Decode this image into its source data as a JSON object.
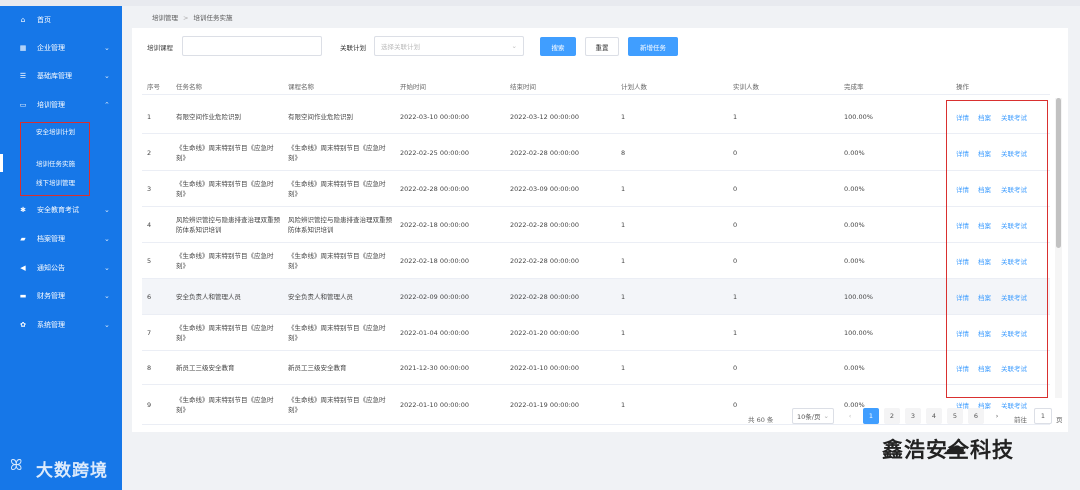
{
  "sidebar": {
    "items": [
      {
        "label": "首页",
        "icon": "home-icon",
        "glyph": "⌂"
      },
      {
        "label": "企业管理",
        "icon": "building-icon",
        "glyph": "▦"
      },
      {
        "label": "基础库管理",
        "icon": "list-icon",
        "glyph": "☰"
      },
      {
        "label": "培训管理",
        "icon": "monitor-icon",
        "glyph": "▭"
      },
      {
        "label": "安全教育考试",
        "icon": "gear-icon",
        "glyph": "✱"
      },
      {
        "label": "档案管理",
        "icon": "folder-icon",
        "glyph": "▰"
      },
      {
        "label": "通知公告",
        "icon": "megaphone-icon",
        "glyph": "◀"
      },
      {
        "label": "财务管理",
        "icon": "card-icon",
        "glyph": "▬"
      },
      {
        "label": "系统管理",
        "icon": "settings-icon",
        "glyph": "✿"
      }
    ],
    "sub_items": [
      "安全培训计划",
      "培训任务实施",
      "线下培训管理"
    ],
    "logo_text": "大数跨境"
  },
  "breadcrumb": [
    "培训管理",
    "培训任务实施"
  ],
  "filters": {
    "course_label": "培训课程",
    "course_value": "",
    "plan_label": "关联计划",
    "plan_placeholder": "选择关联计划",
    "search_btn": "搜索",
    "reset_btn": "重置",
    "new_btn": "新增任务"
  },
  "table": {
    "headers": [
      "序号",
      "任务名称",
      "课程名称",
      "开始时间",
      "结束时间",
      "计划人数",
      "实训人数",
      "完成率",
      "操作"
    ],
    "rows": [
      {
        "no": "1",
        "task": "有限空间作业危险识别",
        "course": "有限空间作业危险识别",
        "start": "2022-03-10 00:00:00",
        "end": "2022-03-12 00:00:00",
        "plan": "1",
        "actual": "1",
        "rate": "100.00%"
      },
      {
        "no": "2",
        "task": "《生命线》周末特别节目《应急时刻》",
        "course": "《生命线》周末特别节目《应急时刻》",
        "start": "2022-02-25 00:00:00",
        "end": "2022-02-28 00:00:00",
        "plan": "8",
        "actual": "0",
        "rate": "0.00%"
      },
      {
        "no": "3",
        "task": "《生命线》周末特别节目《应急时刻》",
        "course": "《生命线》周末特别节目《应急时刻》",
        "start": "2022-02-28 00:00:00",
        "end": "2022-03-09 00:00:00",
        "plan": "1",
        "actual": "0",
        "rate": "0.00%"
      },
      {
        "no": "4",
        "task": "风险辨识管控与隐患排查治理双重预防体系知识培训",
        "course": "风险辨识管控与隐患排查治理双重预防体系知识培训",
        "start": "2022-02-18 00:00:00",
        "end": "2022-02-28 00:00:00",
        "plan": "1",
        "actual": "0",
        "rate": "0.00%"
      },
      {
        "no": "5",
        "task": "《生命线》周末特别节目《应急时刻》",
        "course": "《生命线》周末特别节目《应急时刻》",
        "start": "2022-02-18 00:00:00",
        "end": "2022-02-28 00:00:00",
        "plan": "1",
        "actual": "0",
        "rate": "0.00%"
      },
      {
        "no": "6",
        "task": "安全负责人和管理人员",
        "course": "安全负责人和管理人员",
        "start": "2022-02-09 00:00:00",
        "end": "2022-02-28 00:00:00",
        "plan": "1",
        "actual": "1",
        "rate": "100.00%"
      },
      {
        "no": "7",
        "task": "《生命线》周末特别节目《应急时刻》",
        "course": "《生命线》周末特别节目《应急时刻》",
        "start": "2022-01-04 00:00:00",
        "end": "2022-01-20 00:00:00",
        "plan": "1",
        "actual": "1",
        "rate": "100.00%"
      },
      {
        "no": "8",
        "task": "新员工三级安全教育",
        "course": "新员工三级安全教育",
        "start": "2021-12-30 00:00:00",
        "end": "2022-01-10 00:00:00",
        "plan": "1",
        "actual": "0",
        "rate": "0.00%"
      },
      {
        "no": "9",
        "task": "《生命线》周末特别节目《应急时刻》",
        "course": "《生命线》周末特别节目《应急时刻》",
        "start": "2022-01-10 00:00:00",
        "end": "2022-01-19 00:00:00",
        "plan": "1",
        "actual": "0",
        "rate": "0.00%"
      }
    ],
    "ops": [
      "详情",
      "档案",
      "关联考试"
    ]
  },
  "pagination": {
    "total": "共 60 条",
    "page_size": "10条/页",
    "pages": [
      "1",
      "2",
      "3",
      "4",
      "5",
      "6"
    ],
    "prev": "‹",
    "next": "›",
    "goto_label": "前往",
    "goto_value": "1",
    "page_suffix": "页"
  },
  "watermark": "鑫浩安全科技",
  "colors": {
    "sidebar": "#1677e8",
    "primary": "#409eff",
    "highlight": "#d9302f"
  }
}
